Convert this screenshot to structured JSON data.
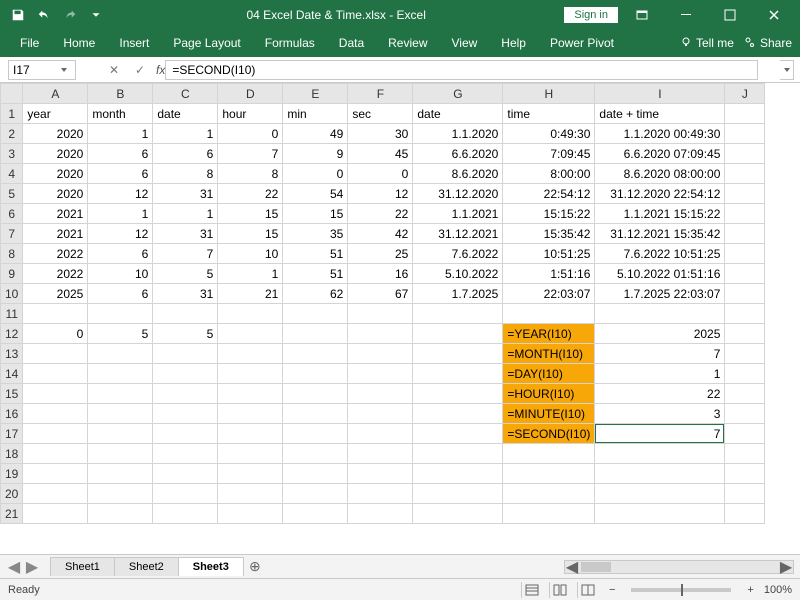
{
  "title": "04 Excel Date & Time.xlsx  -  Excel",
  "signin": "Sign in",
  "ribbon": {
    "tabs": [
      "File",
      "Home",
      "Insert",
      "Page Layout",
      "Formulas",
      "Data",
      "Review",
      "View",
      "Help",
      "Power Pivot"
    ],
    "tellme": "Tell me",
    "share": "Share"
  },
  "namebox": "I17",
  "formula": "=SECOND(I10)",
  "columns": [
    "A",
    "B",
    "C",
    "D",
    "E",
    "F",
    "G",
    "H",
    "I",
    "J"
  ],
  "headers": {
    "A": "year",
    "B": "month",
    "C": "date",
    "D": "hour",
    "E": "min",
    "F": "sec",
    "G": "date",
    "H": "time",
    "I": "date + time"
  },
  "rows": [
    {
      "n": 2,
      "A": 2020,
      "B": 1,
      "C": 1,
      "D": 0,
      "E": 49,
      "F": 30,
      "G": "1.1.2020",
      "H": "0:49:30",
      "I": "1.1.2020 00:49:30"
    },
    {
      "n": 3,
      "A": 2020,
      "B": 6,
      "C": 6,
      "D": 7,
      "E": 9,
      "F": 45,
      "G": "6.6.2020",
      "H": "7:09:45",
      "I": "6.6.2020 07:09:45"
    },
    {
      "n": 4,
      "A": 2020,
      "B": 6,
      "C": 8,
      "D": 8,
      "E": 0,
      "F": 0,
      "G": "8.6.2020",
      "H": "8:00:00",
      "I": "8.6.2020 08:00:00"
    },
    {
      "n": 5,
      "A": 2020,
      "B": 12,
      "C": 31,
      "D": 22,
      "E": 54,
      "F": 12,
      "G": "31.12.2020",
      "H": "22:54:12",
      "I": "31.12.2020 22:54:12"
    },
    {
      "n": 6,
      "A": 2021,
      "B": 1,
      "C": 1,
      "D": 15,
      "E": 15,
      "F": 22,
      "G": "1.1.2021",
      "H": "15:15:22",
      "I": "1.1.2021 15:15:22"
    },
    {
      "n": 7,
      "A": 2021,
      "B": 12,
      "C": 31,
      "D": 15,
      "E": 35,
      "F": 42,
      "G": "31.12.2021",
      "H": "15:35:42",
      "I": "31.12.2021 15:35:42"
    },
    {
      "n": 8,
      "A": 2022,
      "B": 6,
      "C": 7,
      "D": 10,
      "E": 51,
      "F": 25,
      "G": "7.6.2022",
      "H": "10:51:25",
      "I": "7.6.2022 10:51:25"
    },
    {
      "n": 9,
      "A": 2022,
      "B": 10,
      "C": 5,
      "D": 1,
      "E": 51,
      "F": 16,
      "G": "5.10.2022",
      "H": "1:51:16",
      "I": "5.10.2022 01:51:16"
    },
    {
      "n": 10,
      "A": 2025,
      "B": 6,
      "C": 31,
      "D": 21,
      "E": 62,
      "F": 67,
      "G": "1.7.2025",
      "H": "22:03:07",
      "I": "1.7.2025 22:03:07"
    }
  ],
  "row12": {
    "A": 0,
    "B": 5,
    "C": 5
  },
  "formulas_block": [
    {
      "r": 12,
      "H": "=YEAR(I10)",
      "I": 2025
    },
    {
      "r": 13,
      "H": "=MONTH(I10)",
      "I": 7
    },
    {
      "r": 14,
      "H": "=DAY(I10)",
      "I": 1
    },
    {
      "r": 15,
      "H": "=HOUR(I10)",
      "I": 22
    },
    {
      "r": 16,
      "H": "=MINUTE(I10)",
      "I": 3
    },
    {
      "r": 17,
      "H": "=SECOND(I10)",
      "I": 7
    }
  ],
  "sheets": [
    "Sheet1",
    "Sheet2",
    "Sheet3"
  ],
  "active_sheet": "Sheet3",
  "status": "Ready",
  "zoom": "100%"
}
